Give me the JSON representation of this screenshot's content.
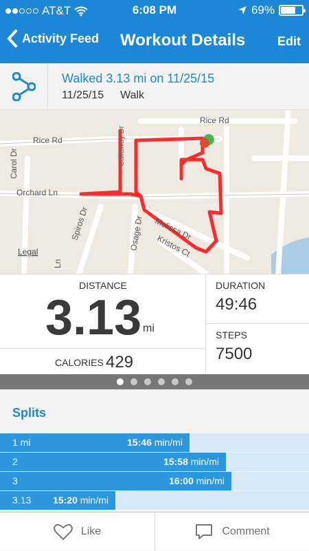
{
  "status_bar": {
    "carrier": "AT&T",
    "time": "6:08 PM",
    "battery": "69%",
    "battery_level": 0.69,
    "signal_bars_on": 2,
    "signal_bars_total": 5
  },
  "nav": {
    "back_label": "Activity Feed",
    "title": "Workout Details",
    "edit_label": "Edit"
  },
  "summary": {
    "headline": "Walked 3.13 mi on 11/25/15",
    "date": "11/25/15",
    "type": "Walk"
  },
  "map": {
    "streets": [
      "Rice Rd",
      "Rice Rd",
      "Carol Dr",
      "Orchard Ln",
      "Spiros Dr",
      "Osage Dr",
      "Melissa Dr",
      "Kristos Ct",
      "Ln",
      "Callaway Dr"
    ],
    "legal_label": "Legal"
  },
  "stats": {
    "distance_label": "DISTANCE",
    "distance_value": "3.13",
    "distance_unit": "mi",
    "calories_label": "CALORIES",
    "calories_value": "429",
    "duration_label": "DURATION",
    "duration_value": "49:46",
    "steps_label": "STEPS",
    "steps_value": "7500"
  },
  "pager": {
    "pages": 6,
    "active": 0
  },
  "splits_title": "Splits",
  "splits": [
    {
      "name": "1 mi",
      "pace": "15:46",
      "unit": "min/mi",
      "fraction": 0.613
    },
    {
      "name": "2",
      "pace": "15:58",
      "unit": "min/mi",
      "fraction": 0.731
    },
    {
      "name": "3",
      "pace": "16:00",
      "unit": "min/mi",
      "fraction": 0.749
    },
    {
      "name": "3.13",
      "pace": "15:20",
      "unit": "min/mi",
      "fraction": 0.373
    }
  ],
  "actions": {
    "like_label": "Like",
    "comment_label": "Comment"
  },
  "colors": {
    "accent": "#1c87d6",
    "route": "#ff2b2b",
    "split_bar": "#2c97dd"
  }
}
